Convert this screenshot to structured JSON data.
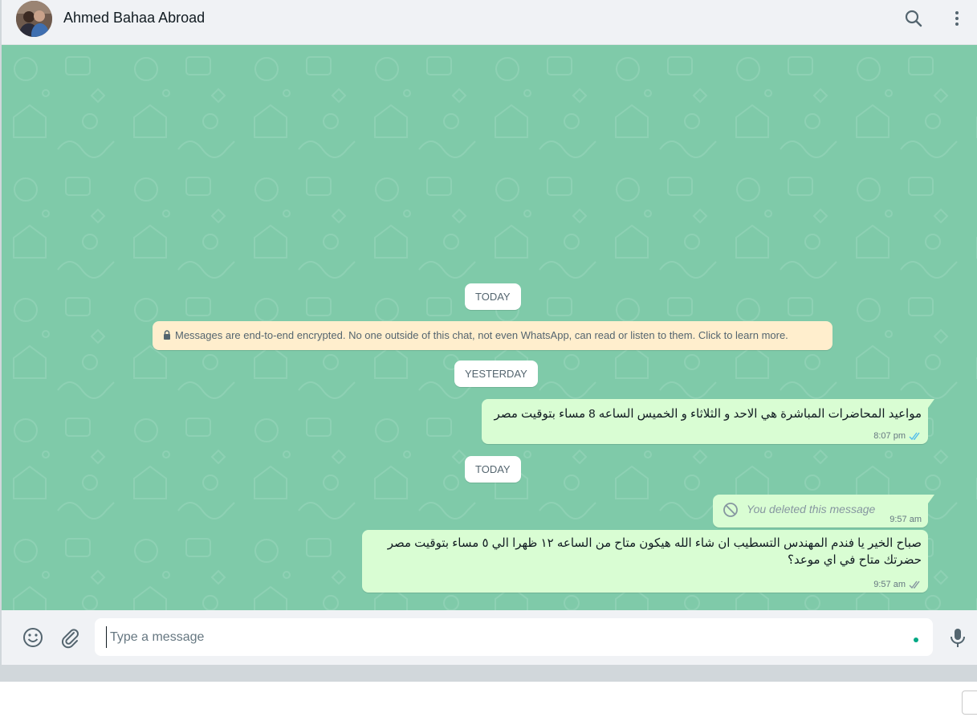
{
  "header": {
    "contact_name": "Ahmed Bahaa Abroad",
    "icons": [
      "avatar",
      "search-icon",
      "menu-icon"
    ]
  },
  "chat": {
    "date_today_1": "TODAY",
    "encryption_notice": "Messages are end-to-end encrypted. No one outside of this chat, not even WhatsApp, can read or listen to them. Click to learn more.",
    "date_yesterday": "YESTERDAY",
    "date_today_2": "TODAY",
    "messages": [
      {
        "text": "مواعيد المحاضرات المباشرة هي الاحد و الثلاثاء و الخميس الساعه 8 مساء بتوقيت مصر",
        "time": "8:07 pm",
        "status": "read"
      },
      {
        "text": "You deleted this message",
        "time": "9:57 am",
        "deleted": true
      },
      {
        "line1": "صباح الخير يا فندم المهندس  التسطيب ان شاء الله هيكون متاح من الساعه ١٢ ظهرا الي ٥ مساء بتوقيت مصر",
        "line2": "حضرتك متاح في اي موعد؟",
        "time": "9:57 am",
        "status": "delivered"
      }
    ]
  },
  "footer": {
    "placeholder": "Type a message",
    "icons": [
      "emoji-icon",
      "attach-icon",
      "mic-icon"
    ]
  },
  "colors": {
    "chat_bg": "#7fcaa9",
    "outgoing_bubble": "#d9fdd3",
    "read_ticks": "#53bdeb",
    "delivered_ticks": "#8696a0",
    "encryption_banner": "#ffeecd"
  }
}
